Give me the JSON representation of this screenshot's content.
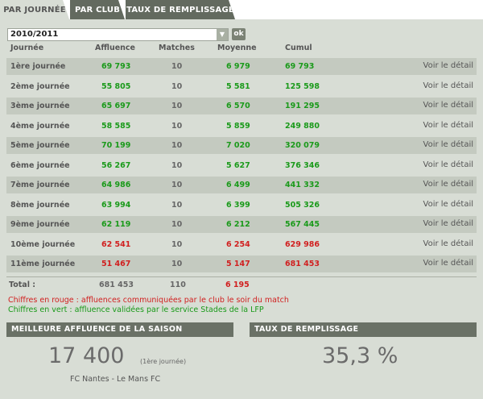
{
  "tabs": [
    "PAR JOURNÉE",
    "PAR CLUB",
    "TAUX DE REMPLISSAGE"
  ],
  "season": {
    "value": "2010/2011",
    "ok_label": "ok"
  },
  "headers": {
    "journee": "Journée",
    "affluence": "Affluence",
    "matches": "Matches",
    "moyenne": "Moyenne",
    "cumul": "Cumul"
  },
  "detail_label": "Voir le détail",
  "rows": [
    {
      "label": "1ère journée",
      "affluence": "69 793",
      "matches": "10",
      "moyenne": "6 979",
      "cumul": "69 793",
      "status": "green"
    },
    {
      "label": "2ème journée",
      "affluence": "55 805",
      "matches": "10",
      "moyenne": "5 581",
      "cumul": "125 598",
      "status": "green"
    },
    {
      "label": "3ème journée",
      "affluence": "65 697",
      "matches": "10",
      "moyenne": "6 570",
      "cumul": "191 295",
      "status": "green"
    },
    {
      "label": "4ème journée",
      "affluence": "58 585",
      "matches": "10",
      "moyenne": "5 859",
      "cumul": "249 880",
      "status": "green"
    },
    {
      "label": "5ème journée",
      "affluence": "70 199",
      "matches": "10",
      "moyenne": "7 020",
      "cumul": "320 079",
      "status": "green"
    },
    {
      "label": "6ème journée",
      "affluence": "56 267",
      "matches": "10",
      "moyenne": "5 627",
      "cumul": "376 346",
      "status": "green"
    },
    {
      "label": "7ème journée",
      "affluence": "64 986",
      "matches": "10",
      "moyenne": "6 499",
      "cumul": "441 332",
      "status": "green"
    },
    {
      "label": "8ème journée",
      "affluence": "63 994",
      "matches": "10",
      "moyenne": "6 399",
      "cumul": "505 326",
      "status": "green"
    },
    {
      "label": "9ème journée",
      "affluence": "62 119",
      "matches": "10",
      "moyenne": "6 212",
      "cumul": "567 445",
      "status": "green"
    },
    {
      "label": "10ème journée",
      "affluence": "62 541",
      "matches": "10",
      "moyenne": "6 254",
      "cumul": "629 986",
      "status": "red"
    },
    {
      "label": "11ème journée",
      "affluence": "51 467",
      "matches": "10",
      "moyenne": "5 147",
      "cumul": "681 453",
      "status": "red"
    }
  ],
  "total": {
    "label": "Total :",
    "affluence": "681 453",
    "matches": "110",
    "moyenne": "6 195"
  },
  "legend": {
    "red": "Chiffres en rouge : affluences communiquées par le club le soir du match",
    "green": "Chiffres en vert : affluence validées par le service Stades de la LFP"
  },
  "best": {
    "title": "MEILLEURE AFFLUENCE DE LA SAISON",
    "value": "17 400",
    "journee": "(1ère journée)",
    "match": "FC Nantes - Le Mans FC"
  },
  "fill": {
    "title": "TAUX DE REMPLISSAGE",
    "value": "35,3 %"
  },
  "colors": {
    "green": "#1a9a1a",
    "red": "#d11f1f",
    "header_bar": "#6a7166"
  }
}
